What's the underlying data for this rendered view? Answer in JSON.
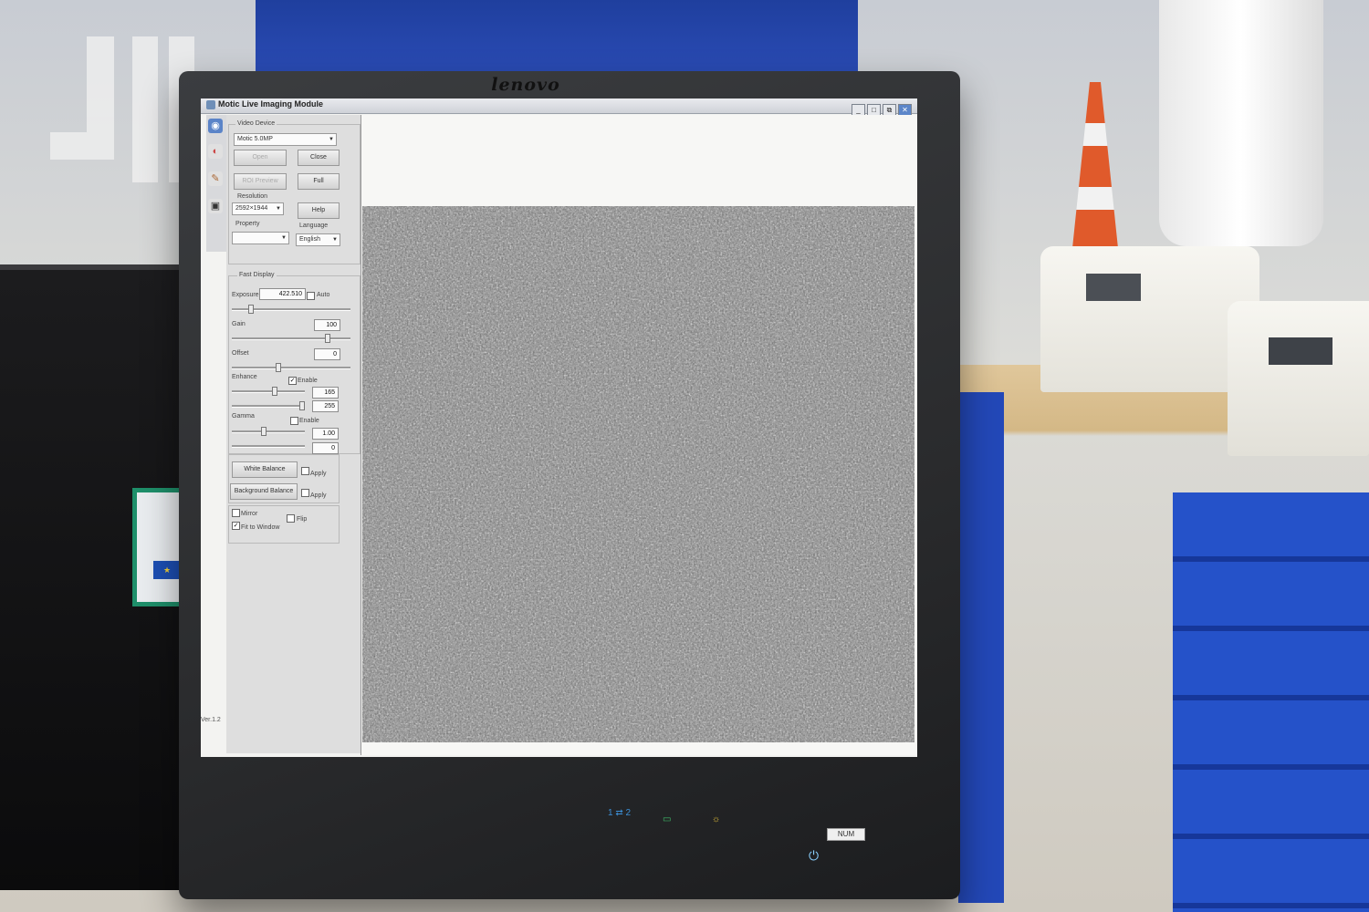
{
  "scene": {
    "brand": "lenovo"
  },
  "app": {
    "title": "Motic Live Imaging Module",
    "window_buttons": [
      "_",
      "□",
      "⧉",
      "✕"
    ],
    "version": "Ver.1.2"
  },
  "video_device": {
    "label": "Video Device",
    "device": "Motic 5.0MP",
    "open_label": "Open",
    "close_label": "Close",
    "roi_label": "ROI Preview",
    "full_label": "Full",
    "resolution_label": "Resolution",
    "resolution": "2592×1944",
    "help_label": "Help",
    "property_label": "Property",
    "property": "",
    "language_label": "Language",
    "language": "English"
  },
  "fast_display": {
    "label": "Fast Display",
    "exposure_label": "Exposure",
    "exposure": "422.510",
    "auto_label": "Auto",
    "gain_label": "Gain",
    "gain": "100",
    "offset_label": "Offset",
    "offset": "0",
    "enhance_label": "Enhance",
    "enable_label": "Enable",
    "enhance_low": "165",
    "enhance_high": "255",
    "gamma_label": "Gamma",
    "gamma_enable_label": "Enable",
    "gamma": "1.00",
    "gamma_extra": "0"
  },
  "balance": {
    "white_balance_label": "White Balance",
    "background_balance_label": "Background Balance",
    "apply_label": "Apply",
    "apply2_label": "Apply"
  },
  "view_opts": {
    "mirror_label": "Mirror",
    "flip_label": "Flip",
    "fit_label": "Fit to Window"
  },
  "monitor": {
    "input_label": "1 ⇄ 2",
    "num_label": "NUM"
  },
  "colors": {
    "panel": "#dedede",
    "titlebar": "#cfd2d8",
    "monitor": "#2a2b2d"
  }
}
